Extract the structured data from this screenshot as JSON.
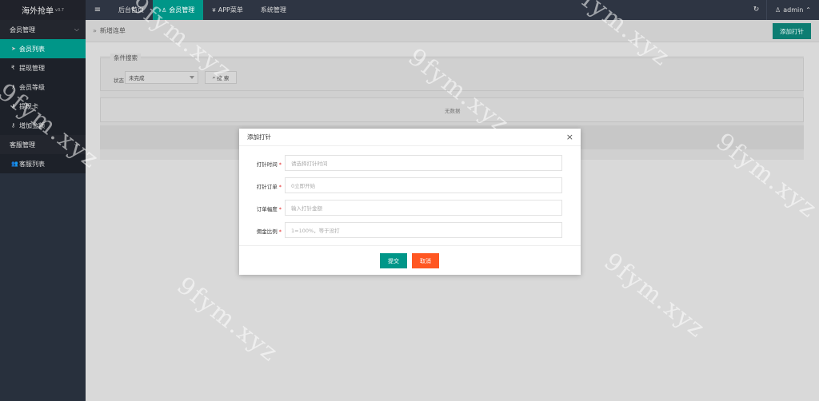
{
  "app": {
    "title": "海外抢单",
    "version": "v3.7"
  },
  "sidebar": {
    "groups": [
      {
        "label": "会员管理",
        "items": [
          {
            "label": "会员列表",
            "icon": "paper-plane-icon"
          },
          {
            "label": "提现管理",
            "icon": "rupee-icon"
          },
          {
            "label": "会员等级",
            "icon": "key-icon"
          },
          {
            "label": "提现卡",
            "icon": "key-icon"
          },
          {
            "label": "增加金额",
            "icon": "key-icon"
          }
        ]
      },
      {
        "label": "客服管理",
        "items": [
          {
            "label": "客服列表",
            "icon": "users-icon"
          }
        ]
      }
    ]
  },
  "topbar": {
    "nav": [
      "后台首页",
      "会员管理",
      "APP菜单",
      "系统管理"
    ],
    "user": "admin"
  },
  "crumb": "新增连单",
  "add_button": "添加打针",
  "search": {
    "legend": "条件搜索",
    "status_label": "状态",
    "status_value": "未完成",
    "search_button": "搜 索"
  },
  "table": {
    "empty_text": "无数据"
  },
  "modal": {
    "title": "添加打针",
    "fields": [
      {
        "label": "打针时间",
        "placeholder": "请选择打针时间"
      },
      {
        "label": "打针订单",
        "placeholder": "0立即开始"
      },
      {
        "label": "订单幅度",
        "placeholder": "输入打针金额"
      },
      {
        "label": "佣金比例",
        "placeholder": "1=100%，等于没打"
      }
    ],
    "submit": "提交",
    "cancel": "取消"
  },
  "watermark": "9fym.xyz",
  "colors": {
    "accent": "#009688",
    "danger": "#ff5722",
    "sidebar": "#28303d"
  }
}
